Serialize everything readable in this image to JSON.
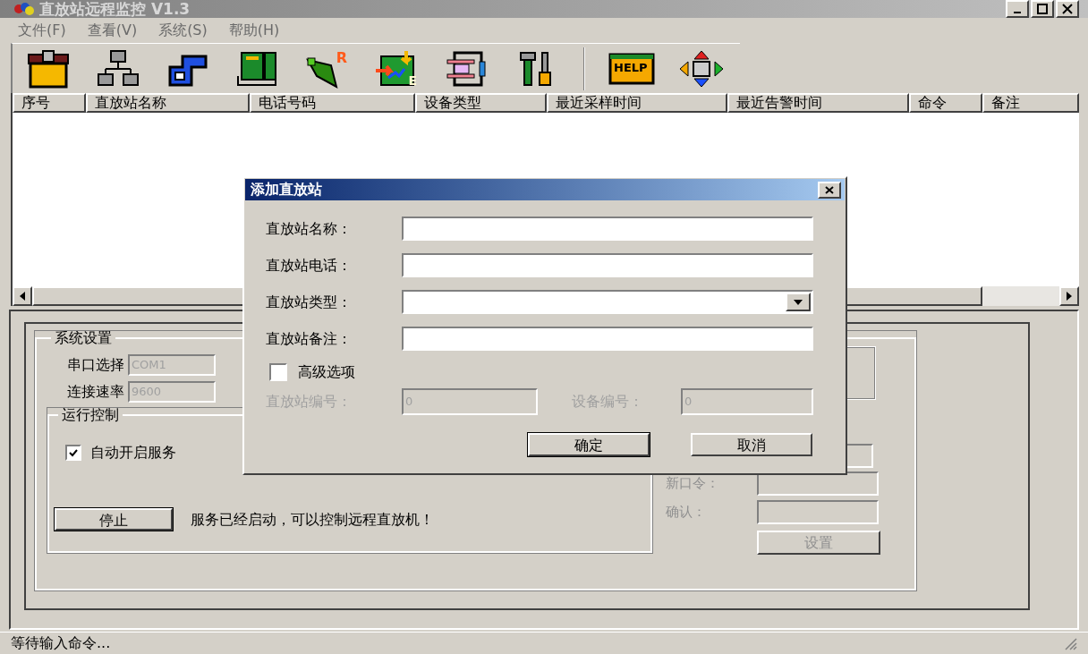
{
  "window": {
    "title": "直放站远程监控 V1.3"
  },
  "menu": [
    {
      "label": "文件(F)"
    },
    {
      "label": "查看(V)"
    },
    {
      "label": "系统(S)"
    },
    {
      "label": "帮助(H)"
    }
  ],
  "toolbar": [
    {
      "kind": "cabinet"
    },
    {
      "kind": "network"
    },
    {
      "kind": "pipe"
    },
    {
      "kind": "phone"
    },
    {
      "kind": "flag",
      "badge": "R"
    },
    {
      "kind": "map",
      "badge": "E"
    },
    {
      "kind": "device"
    },
    {
      "kind": "tools"
    },
    {
      "kind": "help",
      "badge": "HELP",
      "separator_before": true
    },
    {
      "kind": "arrows"
    }
  ],
  "table": {
    "columns": [
      "序号",
      "直放站名称",
      "电话号码",
      "设备类型",
      "最近采样时间",
      "最近告警时间",
      "命令",
      "备注"
    ]
  },
  "system_settings": {
    "title": "系统设置",
    "port_label": "串口选择",
    "port_value": "COM1",
    "baud_label": "连接速率",
    "baud_value": "9600"
  },
  "run_control": {
    "title": "运行控制",
    "auto_start": {
      "label": "自动开启服务",
      "checked": true
    },
    "stop_button": "停止",
    "status": "服务已经启动，可以控制远程直放机！"
  },
  "password": {
    "new_label": "新口令：",
    "confirm_label": "确认：",
    "set_button": "设置",
    "disabled": true
  },
  "dialog": {
    "title": "添加直放站",
    "fields": [
      {
        "label": "直放站名称：",
        "kind": "text"
      },
      {
        "label": "直放站电话：",
        "kind": "text"
      },
      {
        "label": "直放站类型：",
        "kind": "select"
      },
      {
        "label": "直放站备注：",
        "kind": "text"
      }
    ],
    "advanced": {
      "label": "高级选项",
      "checked": false
    },
    "station_no": {
      "label": "直放站编号：",
      "value": "0",
      "disabled": true
    },
    "device_no": {
      "label": "设备编号：",
      "value": "0",
      "disabled": true
    },
    "buttons": [
      {
        "label": "确定",
        "default": true
      },
      {
        "label": "取消",
        "default": false
      }
    ]
  },
  "status_bar": "等待输入命令..."
}
